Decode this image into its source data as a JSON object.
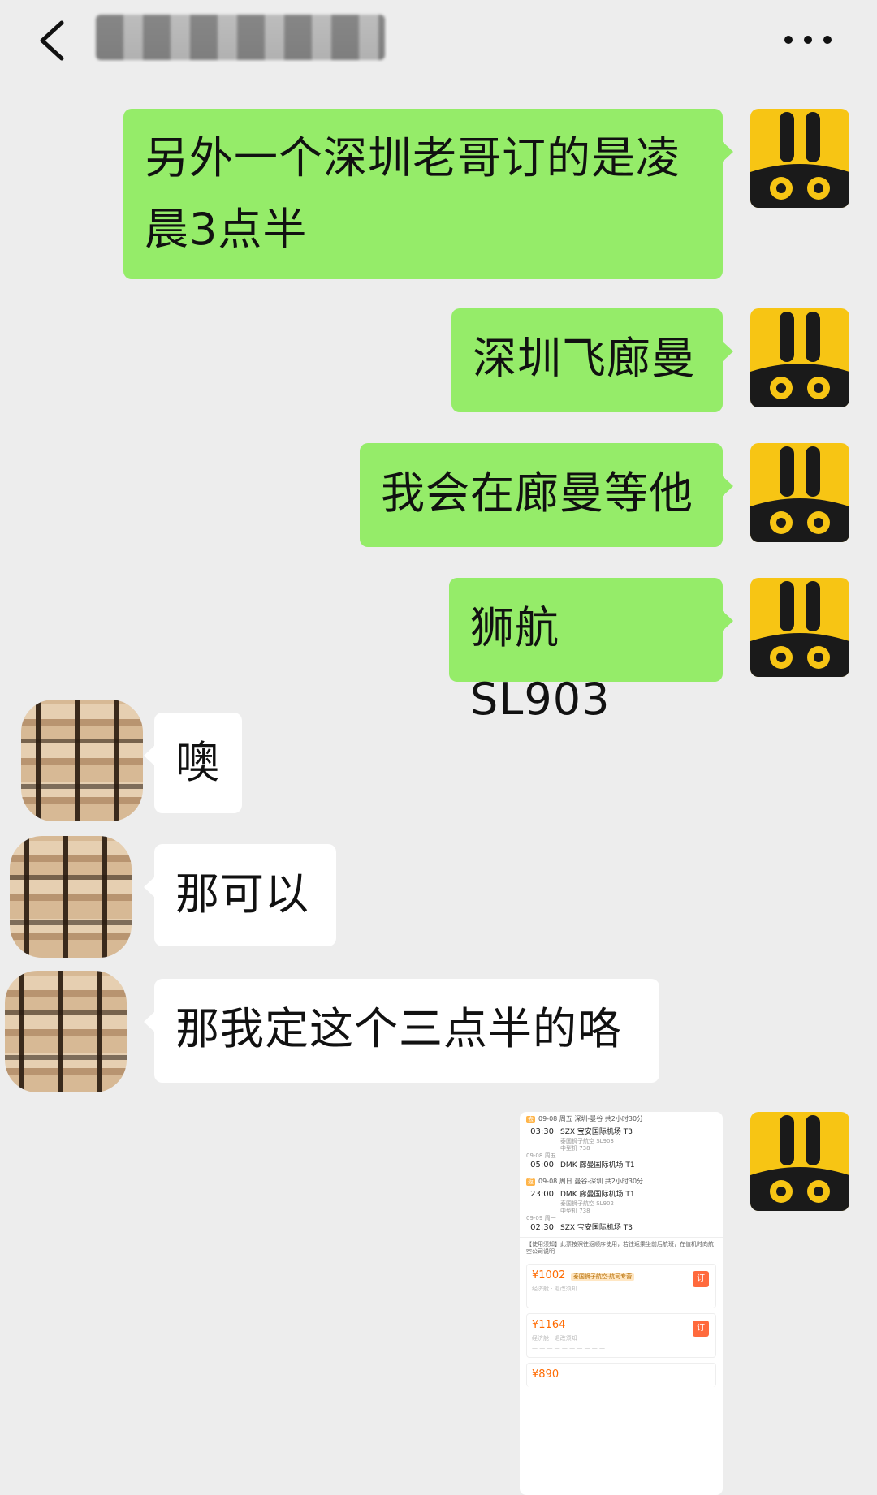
{
  "header": {
    "contact_name": "██████████",
    "back_icon": "chevron-left-icon",
    "more_icon": "more-dots-icon"
  },
  "messages": [
    {
      "side": "out",
      "line1": "另外一个深圳老哥订的是凌",
      "line2": "晨3点半"
    },
    {
      "side": "out",
      "text": "深圳飞廊曼"
    },
    {
      "side": "out",
      "text": "我会在廊曼等他"
    },
    {
      "side": "out",
      "text": "狮航 SL903"
    },
    {
      "side": "in",
      "text": "噢"
    },
    {
      "side": "in",
      "text": "那可以"
    },
    {
      "side": "in",
      "text": "那我定这个三点半的咯"
    }
  ],
  "flight_card": {
    "outbound": {
      "tag": "去",
      "header": "09-08 周五 深圳-曼谷 共2小时30分",
      "dep_time": "03:30",
      "dep_airport": "SZX 宝安国际机场 T3",
      "airline": "泰国狮子航空 SL903",
      "sub": "中型机 738",
      "arr_date": "09-08 周五",
      "arr_time": "05:00",
      "arr_airport": "DMK 廊曼国际机场 T1"
    },
    "return": {
      "tag": "返",
      "header": "09-08 周日 曼谷-深圳 共2小时30分",
      "dep_time": "23:00",
      "dep_airport": "DMK 廊曼国际机场 T1",
      "airline": "泰国狮子航空 SL902",
      "sub": "中型机 738",
      "arr_date": "09-09 周一",
      "arr_time": "02:30",
      "arr_airport": "SZX 宝安国际机场 T3"
    },
    "note": "【使用须知】此票按照往返顺序使用，若往返乘坐前后航班，在值机时向航空公司说明",
    "offers": [
      {
        "price": "¥1002",
        "pill": "泰国狮子航空·航司专营",
        "class": "经济舱 · 退改须知",
        "order": "订"
      },
      {
        "price": "¥1164",
        "pill": "",
        "class": "经济舱 · 退改须知",
        "order": "订"
      },
      {
        "price": "¥890",
        "pill": "",
        "class": "",
        "order": ""
      }
    ]
  }
}
